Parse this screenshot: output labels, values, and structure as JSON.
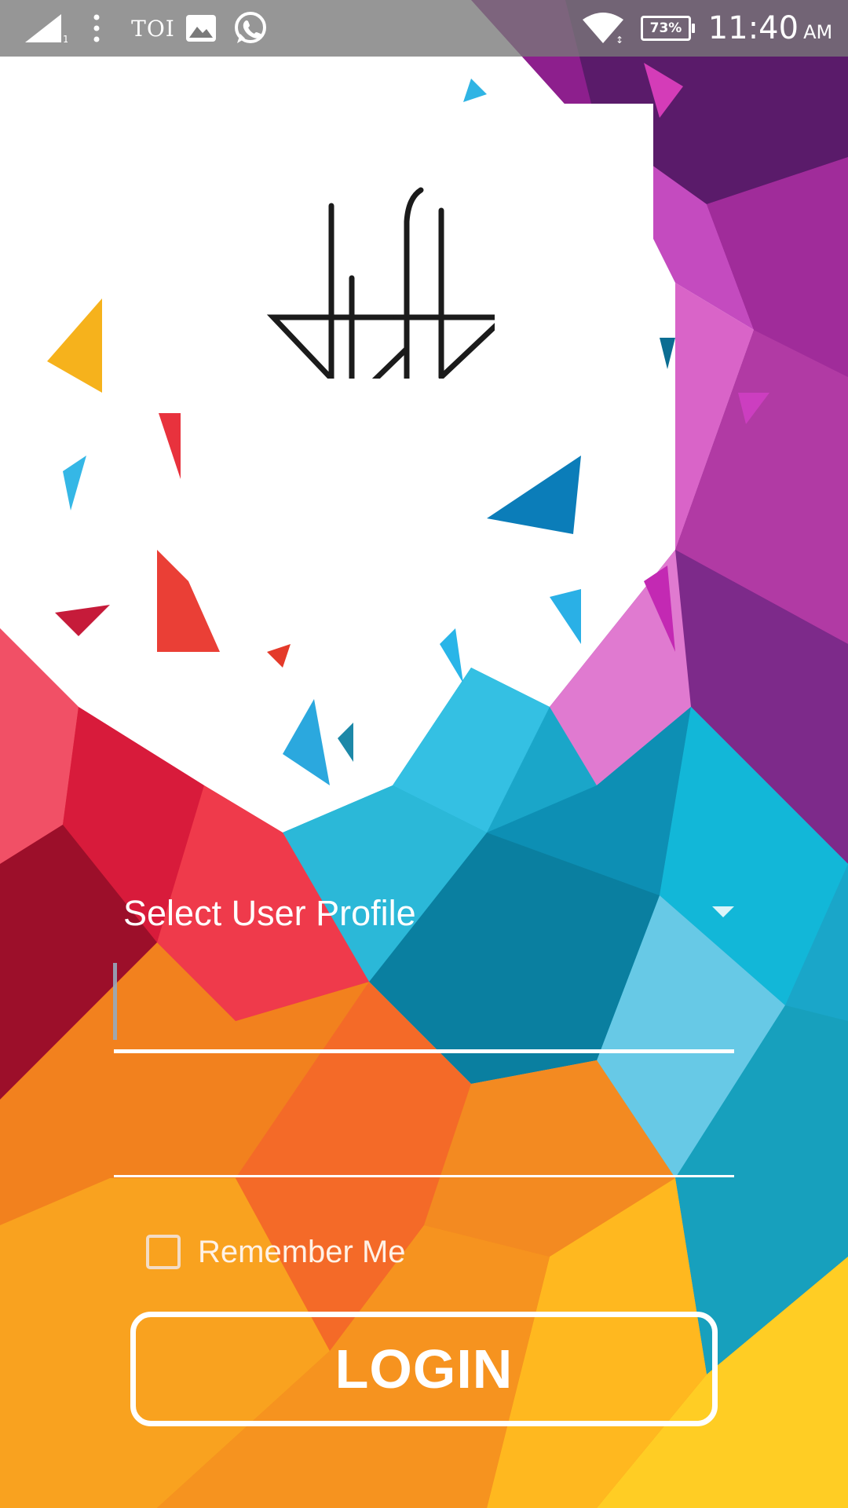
{
  "status_bar": {
    "carrier_app": "TOI",
    "battery": "73%",
    "time": "11:40",
    "ampm": "AM",
    "icons": [
      "signal-icon",
      "overflow-menu-icon",
      "gallery-icon",
      "whatsapp-icon",
      "wifi-icon",
      "battery-icon"
    ]
  },
  "logo": {
    "icon": "brand-logo-icon"
  },
  "form": {
    "profile_select_label": "Select User Profile",
    "username_value": "",
    "password_value": "",
    "remember_label": "Remember Me",
    "remember_checked": false,
    "login_label": "LOGIN"
  },
  "colors": {
    "accent_white": "#ffffff",
    "status_bar": "#7a7a7a"
  }
}
